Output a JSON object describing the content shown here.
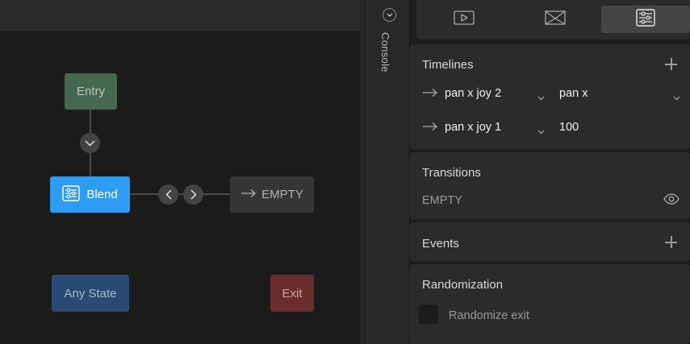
{
  "graph": {
    "nodes": {
      "entry": "Entry",
      "blend": "Blend",
      "empty": "EMPTY",
      "any_state": "Any State",
      "exit": "Exit"
    }
  },
  "console": {
    "label": "Console"
  },
  "panel": {
    "tabs": [
      {
        "icon": "play-icon"
      },
      {
        "icon": "bowtie-icon"
      },
      {
        "icon": "sliders-icon",
        "active": true
      }
    ],
    "timelines": {
      "title": "Timelines",
      "rows": [
        {
          "name": "pan x joy 2",
          "value": "pan x"
        },
        {
          "name": "pan x joy 1",
          "value": "100"
        }
      ]
    },
    "transitions": {
      "title": "Transitions",
      "items": [
        "EMPTY"
      ]
    },
    "events": {
      "title": "Events"
    },
    "randomization": {
      "title": "Randomization",
      "checkbox_label": "Randomize exit"
    }
  },
  "colors": {
    "entry": "#46684f",
    "blend": "#2e9cf2",
    "any_state": "#284a74",
    "exit": "#6a2c2c"
  }
}
